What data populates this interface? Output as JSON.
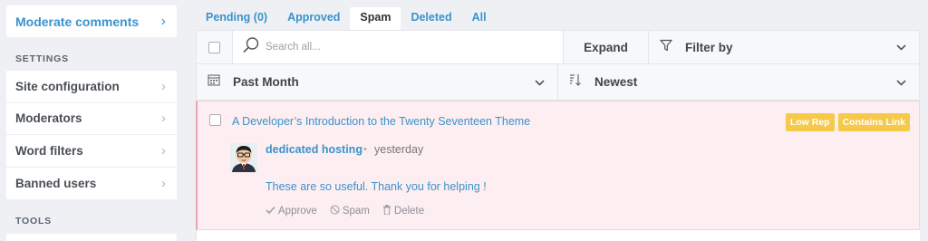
{
  "sidebar": {
    "active_item": {
      "label": "Moderate comments",
      "icon": "chevron-right-icon"
    },
    "settings_heading": "SETTINGS",
    "settings_items": [
      {
        "label": "Site configuration"
      },
      {
        "label": "Moderators"
      },
      {
        "label": "Word filters"
      },
      {
        "label": "Banned users"
      }
    ],
    "tools_heading": "TOOLS"
  },
  "tabs": [
    {
      "label": "Pending (0)",
      "active": false
    },
    {
      "label": "Approved",
      "active": false
    },
    {
      "label": "Spam",
      "active": true
    },
    {
      "label": "Deleted",
      "active": false
    },
    {
      "label": "All",
      "active": false
    }
  ],
  "toolbar": {
    "search_placeholder": "Search all...",
    "expand_label": "Expand",
    "filter_label": "Filter by",
    "date_label": "Past Month",
    "sort_label": "Newest"
  },
  "comment": {
    "post_title": "A Developer’s Introduction to the Twenty Seventeen Theme",
    "badges": [
      "Low Rep",
      "Contains Link"
    ],
    "author": "dedicated hosting",
    "separator": "•",
    "time": "yesterday",
    "body": "These are so useful. Thank you for helping !",
    "actions": {
      "approve": "Approve",
      "spam": "Spam",
      "delete": "Delete"
    }
  },
  "colors": {
    "accent": "#3a93cc",
    "badge": "#f6c94a",
    "spam_row_bg": "#fdeef1"
  }
}
